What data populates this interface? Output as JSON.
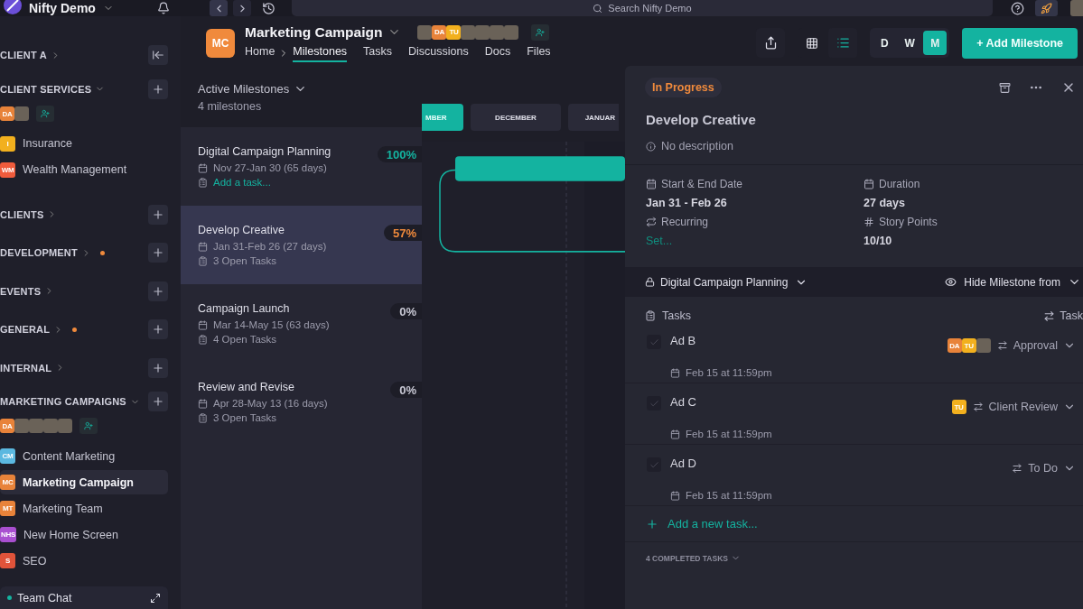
{
  "topbar": {
    "app_name": "Nifty Demo",
    "search_placeholder": "Search Nifty Demo"
  },
  "sidebar": {
    "groups": [
      {
        "name": "CLIENT A",
        "expanded": false,
        "collapse_button": true
      },
      {
        "name": "CLIENT SERVICES",
        "expanded": true,
        "members": [
          {
            "kind": "initials",
            "text": "DA",
            "color": "#e8833a"
          },
          {
            "kind": "photo"
          }
        ],
        "projects": [
          {
            "initials": "I",
            "name": "Insurance",
            "color": "#f2b01e",
            "selected": false
          },
          {
            "initials": "WM",
            "name": "Wealth Management",
            "color": "#ef5b3c",
            "selected": false
          }
        ]
      },
      {
        "name": "CLIENTS",
        "expanded": false
      },
      {
        "name": "DEVELOPMENT",
        "expanded": false,
        "dot": true
      },
      {
        "name": "EVENTS",
        "expanded": false
      },
      {
        "name": "GENERAL",
        "expanded": false,
        "dot": true
      },
      {
        "name": "INTERNAL",
        "expanded": false
      },
      {
        "name": "MARKETING CAMPAIGNS",
        "expanded": true,
        "members": [
          {
            "kind": "initials",
            "text": "DA",
            "color": "#e8833a"
          },
          {
            "kind": "photo"
          },
          {
            "kind": "photo"
          },
          {
            "kind": "photo"
          },
          {
            "kind": "photo"
          }
        ],
        "projects": [
          {
            "initials": "CM",
            "name": "Content Marketing",
            "color": "#5bb8e0",
            "selected": false
          },
          {
            "initials": "MC",
            "name": "Marketing Campaign",
            "color": "#e8833a",
            "selected": true
          },
          {
            "initials": "MT",
            "name": "Marketing Team",
            "color": "#e8833a",
            "selected": false
          },
          {
            "initials": "NHS",
            "name": "New Home Screen",
            "color": "#a94fd0",
            "selected": false
          },
          {
            "initials": "S",
            "name": "SEO",
            "color": "#e0533a",
            "selected": false
          }
        ]
      }
    ],
    "team_chat": "Team Chat"
  },
  "project": {
    "initials": "MC",
    "title": "Marketing Campaign",
    "members": [
      {
        "kind": "photo"
      },
      {
        "kind": "initials",
        "text": "DA",
        "color": "#e8833a"
      },
      {
        "kind": "initials",
        "text": "TU",
        "color": "#f2b01e"
      },
      {
        "kind": "photo"
      },
      {
        "kind": "photo"
      },
      {
        "kind": "photo"
      },
      {
        "kind": "photo"
      }
    ],
    "tabs": [
      {
        "label": "Home",
        "selected": false
      },
      {
        "label": "Milestones",
        "selected": true
      },
      {
        "label": "Tasks",
        "selected": false
      },
      {
        "label": "Discussions",
        "selected": false
      },
      {
        "label": "Docs",
        "selected": false
      },
      {
        "label": "Files",
        "selected": false
      }
    ]
  },
  "toolbar": {
    "views": [
      {
        "kind": "grid",
        "selected": false
      },
      {
        "kind": "list",
        "selected": true
      }
    ],
    "scale": [
      {
        "label": "D",
        "selected": false
      },
      {
        "label": "W",
        "selected": false
      },
      {
        "label": "M",
        "selected": true
      }
    ],
    "add_button": "+ Add Milestone"
  },
  "milestones": {
    "heading": "Active Milestones",
    "count": "4 milestones",
    "items": [
      {
        "name": "Digital Campaign Planning",
        "dates": "Nov 27-Jan 30 (65 days)",
        "percent": "100%",
        "kind": "complete",
        "add_task": "Add a task...",
        "selected": false
      },
      {
        "name": "Develop Creative",
        "dates": "Jan 31-Feb 26 (27 days)",
        "percent": "57%",
        "kind": "in_progress",
        "open_tasks": "3 Open Tasks",
        "selected": true
      },
      {
        "name": "Campaign Launch",
        "dates": "Mar 14-May 15 (63 days)",
        "percent": "0%",
        "kind": "not_started",
        "open_tasks": "4 Open Tasks",
        "selected": false
      },
      {
        "name": "Review and Revise",
        "dates": "Apr 28-May 13 (16 days)",
        "percent": "0%",
        "kind": "not_started",
        "open_tasks": "3 Open Tasks",
        "selected": false
      }
    ]
  },
  "gantt": {
    "months": [
      {
        "label": "MBER",
        "selected": true
      },
      {
        "label": "DECEMBER",
        "selected": false
      },
      {
        "label": "JANUAR",
        "selected": false
      }
    ]
  },
  "detail": {
    "status": "In Progress",
    "title": "Develop Creative",
    "description": "No description",
    "fields": [
      {
        "kind": "date_range",
        "label": "Start & End Date",
        "value": "Jan 31 - Feb 26"
      },
      {
        "kind": "duration",
        "label": "Duration",
        "value": "27 days"
      },
      {
        "kind": "recurring",
        "label": "Recurring",
        "link": "Set..."
      },
      {
        "kind": "points",
        "label": "Story Points",
        "value": "10/10"
      }
    ],
    "dependency": "Digital Campaign Planning",
    "hide_label": "Hide Milestone from",
    "tasks_heading": "Tasks",
    "tasks_sort": "Task",
    "tasks": [
      {
        "name": "Ad B",
        "due": "Feb 15 at 11:59pm",
        "status": "Approval",
        "checked": false,
        "assignees": [
          {
            "kind": "initials",
            "text": "DA",
            "color": "#e8833a"
          },
          {
            "kind": "initials",
            "text": "TU",
            "color": "#f2b01e"
          },
          {
            "kind": "photo"
          }
        ]
      },
      {
        "name": "Ad C",
        "due": "Feb 15 at 11:59pm",
        "status": "Client Review",
        "checked": false,
        "assignees": [
          {
            "kind": "initials",
            "text": "TU",
            "color": "#f2b01e"
          }
        ]
      },
      {
        "name": "Ad D",
        "due": "Feb 15 at 11:59pm",
        "status": "To Do",
        "checked": false
      }
    ],
    "add_task": "Add a new task...",
    "completed": "4 COMPLETED TASKS"
  }
}
